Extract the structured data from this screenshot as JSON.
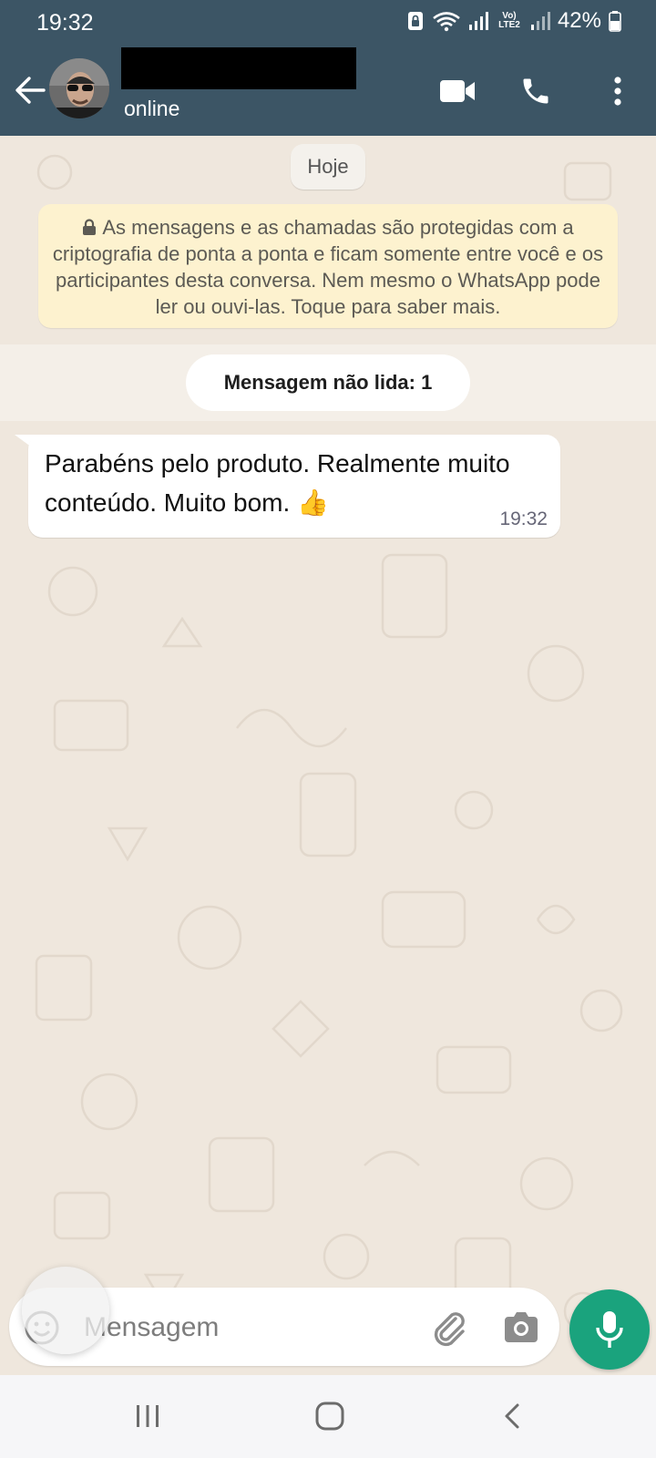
{
  "status_bar": {
    "time": "19:32",
    "network_label": "Vo) LTE2",
    "battery": "42%"
  },
  "header": {
    "contact_status": "online",
    "icons": [
      "back-arrow-icon",
      "video-call-icon",
      "phone-icon",
      "more-vert-icon"
    ]
  },
  "chat": {
    "date_chip": "Hoje",
    "encryption_notice": "As mensagens e as chamadas são protegidas com a criptografia de ponta a ponta e ficam somente entre você e os participantes desta conversa. Nem mesmo o WhatsApp pode ler ou ouvi-las. Toque para saber mais.",
    "unread_label": "Mensagem não lida: 1",
    "messages": [
      {
        "text": "Parabéns pelo produto. Realmente muito conteúdo. Muito bom. 👍",
        "time": "19:32",
        "direction": "incoming"
      }
    ]
  },
  "composer": {
    "placeholder": "Mensagem",
    "icons": [
      "emoji-icon",
      "paperclip-icon",
      "camera-icon",
      "microphone-icon"
    ]
  },
  "nav_bar": {
    "icons": [
      "recent-apps-icon",
      "home-icon",
      "back-icon"
    ]
  },
  "colors": {
    "header": "#3c5565",
    "chat_background": "#efe7dd",
    "notice_background": "#fdf2cf",
    "mic_button": "#1aa37d"
  }
}
